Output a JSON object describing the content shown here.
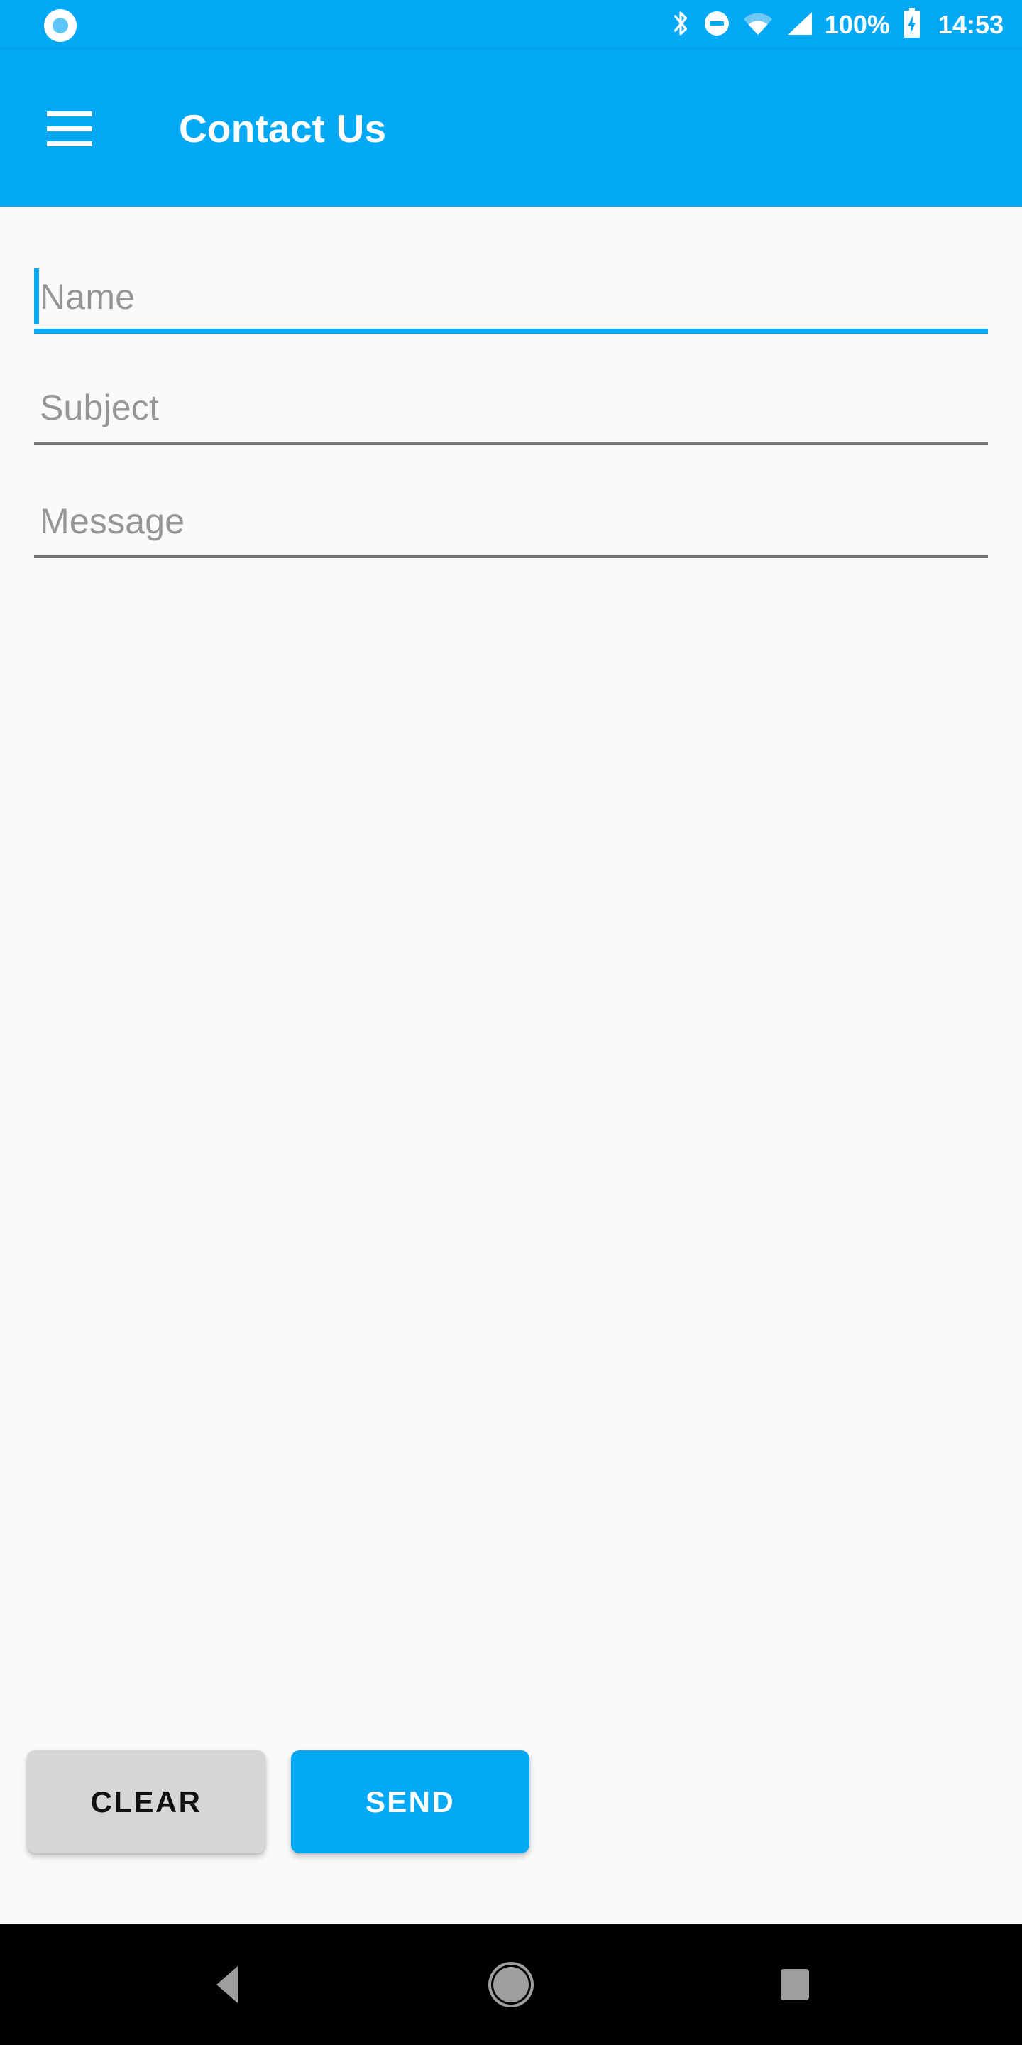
{
  "status_bar": {
    "background_color": "#03A9F4",
    "notification_icon": "circle-notification-icon",
    "icons": [
      "bluetooth-icon",
      "do-not-disturb-icon",
      "wifi-icon",
      "cellular-signal-icon"
    ],
    "battery_percent": "100%",
    "battery_icon": "battery-charging-icon",
    "time": "14:53"
  },
  "app_bar": {
    "title": "Contact Us",
    "menu_icon": "hamburger-menu-icon",
    "background_color": "#03A9F4",
    "text_color": "#FFFFFF"
  },
  "form": {
    "fields": [
      {
        "name": "name",
        "placeholder": "Name",
        "value": "",
        "focused": true
      },
      {
        "name": "subject",
        "placeholder": "Subject",
        "value": "",
        "focused": false
      },
      {
        "name": "message",
        "placeholder": "Message",
        "value": "",
        "focused": false
      }
    ]
  },
  "actions": {
    "clear_label": "CLEAR",
    "send_label": "SEND",
    "clear_color": "#D6D6D6",
    "send_color": "#03A9F4"
  },
  "nav_bar": {
    "background_color": "#000000",
    "buttons": [
      {
        "name": "back",
        "icon": "triangle-back-icon"
      },
      {
        "name": "home",
        "icon": "circle-home-icon"
      },
      {
        "name": "recents",
        "icon": "square-recents-icon"
      }
    ]
  }
}
